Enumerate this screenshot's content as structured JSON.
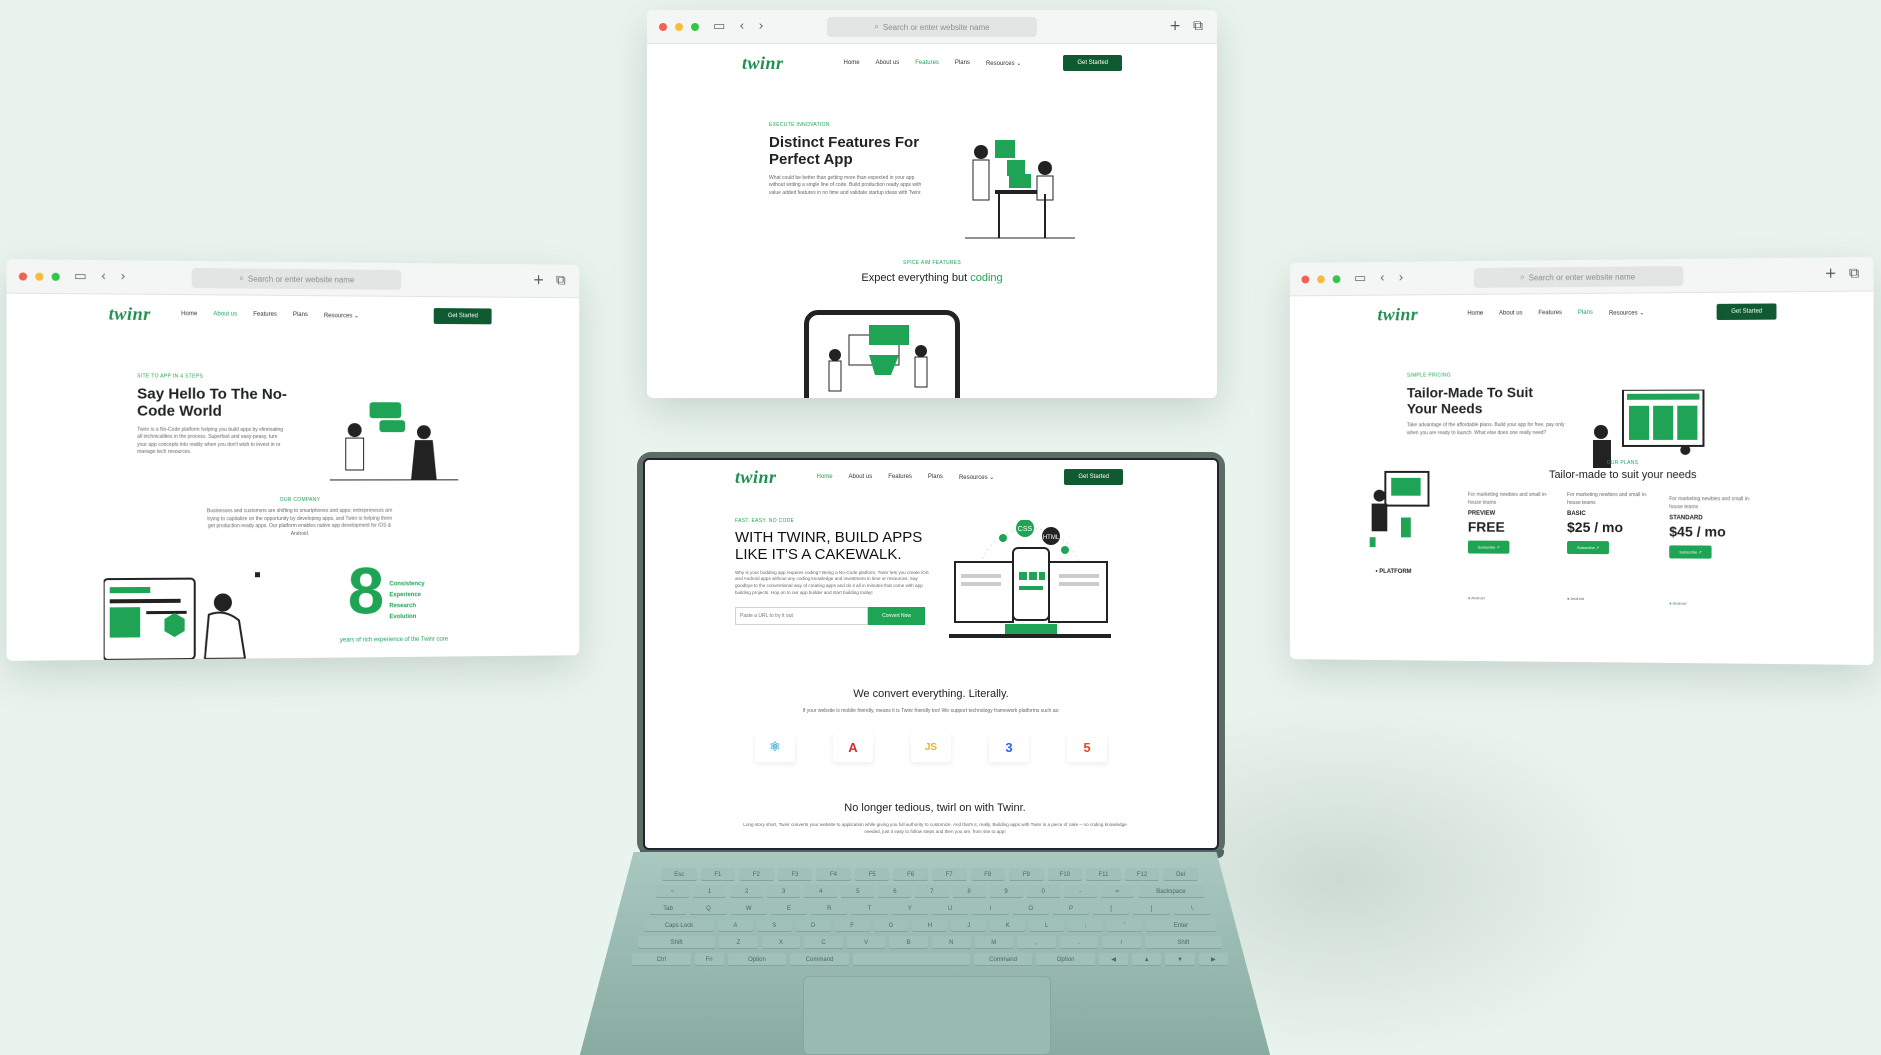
{
  "common": {
    "url_placeholder": "Search or enter website name",
    "logo": "twinr",
    "nav": [
      "Home",
      "About us",
      "Features",
      "Plans",
      "Resources ⌄"
    ],
    "cta": "Get Started"
  },
  "left_window": {
    "eyebrow": "SITE TO APP IN 4 STEPS",
    "title": "Say Hello To The No-Code World",
    "body": "Twinr is a No-Code platform helping you build apps by eliminating all technicalities in the process. Superfast and easy-peasy, turn your app concepts into reality when you don't wish to invest in or manage tech resources.",
    "company_eyebrow": "OUR COMPANY",
    "company_text": "Businesses and customers are shifting to smartphones and apps; entrepreneurs are trying to capitalize on the opportunity by developing apps, and Twinr is helping them get production-ready apps. Our platform enables native app development for iOS & Android.",
    "big_number": "8",
    "pillars": [
      "Consistency",
      "Experience",
      "Research",
      "Evolution"
    ],
    "years_text": "years of rich experience of the Twinr core"
  },
  "top_window": {
    "eyebrow": "EXECUTE INNOVATION",
    "title": "Distinct Features For Perfect App",
    "body": "What could be better than getting more than expected in your app without writing a single line of code. Build production ready apps with value added features in no time and validate startup ideas with Twinr.",
    "sub_eyebrow": "SPICE AIM FEATURES",
    "sub_title_plain": "Expect everything but ",
    "sub_title_green": "coding"
  },
  "right_window": {
    "eyebrow": "SIMPLE PRICING",
    "title": "Tailor-Made To Suit Your Needs",
    "body": "Take advantage of the affordable plans. Build your app for free, pay only when you are ready to launch. What else does one really need?",
    "plans_eyebrow": "OUR PLANS",
    "plans_title": "Tailor-made to suit your needs",
    "platform_label": "PLATFORM",
    "plans": [
      {
        "desc": "For marketing newbies and small in-house teams",
        "name": "PREVIEW",
        "price": "FREE",
        "btn": "Subscribe ↗"
      },
      {
        "desc": "For marketing newbies and small in-house teams",
        "name": "BASIC",
        "price": "$25 / mo",
        "btn": "Subscribe ↗"
      },
      {
        "desc": "For marketing newbies and small in-house teams",
        "name": "STANDARD",
        "price": "$45 / mo",
        "btn": "Subscribe ↗"
      }
    ],
    "os": [
      "Android",
      "Android",
      "Android"
    ]
  },
  "laptop": {
    "eyebrow": "FAST. EASY. NO CODE",
    "title": "WITH TWINR, BUILD APPS LIKE IT'S A CAKEWALK.",
    "body": "Why is your budding app requires coding? Being a No-Code platform, Twinr lets you create iOS and Android apps without any coding knowledge and investment in time or resources. Say goodbye to the conventional way of creating apps and do it all in minutes that come with app building projects. Hop on to our app builder and start building today!",
    "input_placeholder": "Paste a URL to try it out",
    "convert_btn": "Convert Now",
    "convert_title": "We convert everything. Literally.",
    "convert_sub": "If your website is mobile friendly, means it is Twinr friendly too! We support technology framework platforms such as:",
    "frameworks": [
      "⚛",
      "A",
      "JS",
      "3",
      "5"
    ],
    "bottom_title": "No longer tedious, twirl on with Twinr.",
    "bottom_text": "Long story short, Twinr converts your website to application while giving you full authority to customize. And that's it, really. Building apps with Twinr is a piece of cake – no coding knowledge needed, just it easy to follow steps and then you are, from site to app!",
    "css_badge": "CSS",
    "html_badge": "HTML"
  },
  "keyboard": {
    "row1": [
      "Esc",
      "F1",
      "F2",
      "F3",
      "F4",
      "F5",
      "F6",
      "F7",
      "F8",
      "F9",
      "F10",
      "F11",
      "F12",
      "Del"
    ],
    "row2": [
      "~",
      "1",
      "2",
      "3",
      "4",
      "5",
      "6",
      "7",
      "8",
      "9",
      "0",
      "-",
      "=",
      "Backspace"
    ],
    "row3": [
      "Tab",
      "Q",
      "W",
      "E",
      "R",
      "T",
      "Y",
      "U",
      "I",
      "O",
      "P",
      "[",
      "]",
      "\\"
    ],
    "row4": [
      "Caps Lock",
      "A",
      "S",
      "D",
      "F",
      "G",
      "H",
      "J",
      "K",
      "L",
      ";",
      "'",
      "Enter"
    ],
    "row5": [
      "Shift",
      "Z",
      "X",
      "C",
      "V",
      "B",
      "N",
      "M",
      ",",
      ".",
      "/",
      "Shift"
    ],
    "row6": [
      "Ctrl",
      "Fn",
      "Option",
      "Command",
      "",
      "Command",
      "Option",
      "◀",
      "▲",
      "▼",
      "▶"
    ]
  },
  "colors": {
    "brand": "#1fa455",
    "brand_dark": "#0f5a30",
    "bg": "#eaf4ee"
  }
}
